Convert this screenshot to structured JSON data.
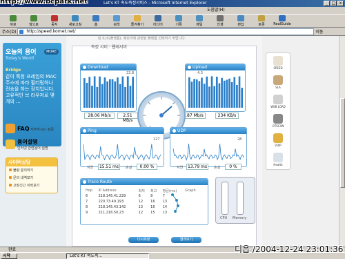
{
  "window": {
    "title": "Let's KT 속도측정서비스 - Microsoft Internet Explorer",
    "watermark": "http://www.bcpark.net"
  },
  "menubar": {
    "help": "도움말(H)"
  },
  "toolbar": {
    "items": [
      "뒤로",
      "앞으로",
      "중지",
      "새로고침",
      "홈",
      "검색",
      "즐겨찾기",
      "미디어",
      "기록",
      "메일",
      "인쇄",
      "편집",
      "토론",
      "RealGuide"
    ]
  },
  "address": {
    "label": "주소(D)",
    "url": "http://speed.kornet.net/",
    "go": "이동"
  },
  "leftcol": {
    "word": {
      "title": "오늘의 용어",
      "subtitle": "Today's Word!",
      "more": "MORE",
      "term": "Bridge",
      "desc": "같이 특정 프레임의 MAC 주소에 따라 필터링하나 전송을 하는 장치입니다. 고유적인 브 라우저로 몇개의 ..."
    },
    "faq": {
      "title": "FAQ",
      "desc": "자주하시는 질문"
    },
    "glossary": {
      "title": "용어설명",
      "desc": "인터넷 관련용어 설명"
    },
    "cyber": {
      "title": "사이버상담",
      "items": [
        "불량 문의하기",
        "문의 내역보기",
        "고장신고 이력보기"
      ]
    }
  },
  "main": {
    "topcrop": "된 IL(IG플랫폼), 메모리에 관련된 플랫폼 선택하기 바랍니다.",
    "heading": "측정 서비 : 웹테서버",
    "download": {
      "label": "Download",
      "max": "22.8",
      "kbps": "28.06 Mb/s",
      "mbps": "2.51 MB/s"
    },
    "upload": {
      "label": "Upload",
      "max": "4.3",
      "kbps": "1.87 Mb/s",
      "mbps": "234 KB/s"
    },
    "ping": {
      "label": "Ping",
      "max": "127",
      "avg_label": "지연",
      "avg": "15.51 ms",
      "loss_label": "손실",
      "loss": "0.00 %"
    },
    "udp": {
      "label": "UDP",
      "max": "28",
      "avg_label": "지연",
      "avg": "13.79 ms",
      "loss_label": "손실",
      "loss": "0 %"
    },
    "trace": {
      "label": "Trace Route",
      "headers": [
        "Hop",
        "IP Address",
        "최저",
        "최고",
        "평균(ms)",
        "Graph"
      ],
      "rows": [
        [
          "6",
          "218.145.41.229",
          "6",
          "8",
          "7"
        ],
        [
          "7",
          "220.73.49.193",
          "12",
          "16",
          "13"
        ],
        [
          "8",
          "218.145.43.142",
          "13",
          "16",
          "14"
        ],
        [
          "9",
          "211.216.50.23",
          "12",
          "15",
          "13"
        ]
      ]
    },
    "mem": {
      "cpu": "CPU",
      "memory": "Memory"
    },
    "buttons": [
      "다시측정",
      "결과보기"
    ]
  },
  "side": {
    "items": [
      "SPEED",
      "SLA",
      "WEB LOAD",
      "OTSCAN",
      "VOIP",
      "Health"
    ]
  },
  "status": {
    "text": "완료"
  },
  "taskbar": {
    "start": "시작",
    "task": "Let's KT 속도측..."
  },
  "stamp": "디읍 /2004-12-24 23:01:36"
}
